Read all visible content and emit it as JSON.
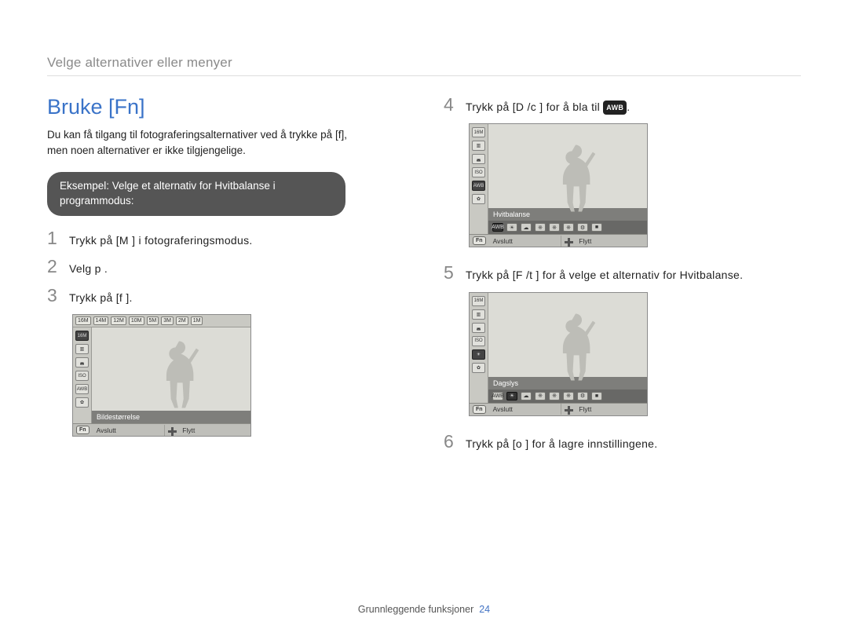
{
  "header": "Velge alternativer eller menyer",
  "title": "Bruke [Fn]",
  "intro_line1": "Du kan få tilgang til fotograferingsalternativer ved å trykke på [f],",
  "intro_line2": "men noen alternativer er ikke tilgjengelige.",
  "callout": "Eksempel: Velge et alternativ for Hvitbalanse i programmodus:",
  "steps": {
    "s1": {
      "num": "1",
      "text": "Trykk på [M       ] i fotograferingsmodus."
    },
    "s2": {
      "num": "2",
      "text": "Velg p ."
    },
    "s3": {
      "num": "3",
      "text": "Trykk på [f    ]."
    },
    "s4": {
      "num": "4",
      "text": "Trykk på [D       /c    ] for å bla til "
    },
    "s4_icon": "AWB",
    "s4_tail": ".",
    "s5": {
      "num": "5",
      "text": "Trykk på [F /t    ] for å velge et alternativ for Hvitbalanse."
    },
    "s6": {
      "num": "6",
      "text": "Trykk på [o    ] for å lagre innstillingene."
    }
  },
  "lcd1": {
    "top_chips": [
      "16M",
      "14M",
      "12M",
      "10M",
      "5M",
      "3M",
      "2M",
      "1M"
    ],
    "side_icons": [
      "16M",
      "▥",
      "◛",
      "ISO",
      "AWB",
      "✿",
      "Fn"
    ],
    "label": "Bildestørrelse",
    "foot_left": "Avslutt",
    "foot_right": "Flytt",
    "fn": "Fn"
  },
  "lcd2": {
    "side_icons": [
      "16M",
      "▥",
      "◛",
      "ISO",
      "AWB",
      "✿",
      "Fn"
    ],
    "label": "Hvitbalanse",
    "options": [
      "AWB",
      "☀",
      "☁",
      "※",
      "※",
      "※",
      "⚙",
      "■"
    ],
    "foot_left": "Avslutt",
    "foot_right": "Flytt",
    "fn": "Fn"
  },
  "lcd3": {
    "side_icons": [
      "16M",
      "▥",
      "◛",
      "ISO",
      "☀",
      "✿",
      "Fn"
    ],
    "label": "Dagslys",
    "options": [
      "AWB",
      "☀",
      "☁",
      "※",
      "※",
      "※",
      "⚙",
      "■"
    ],
    "foot_left": "Avslutt",
    "foot_right": "Flytt",
    "fn": "Fn"
  },
  "footer_text": "Grunnleggende funksjoner",
  "footer_page": "24"
}
